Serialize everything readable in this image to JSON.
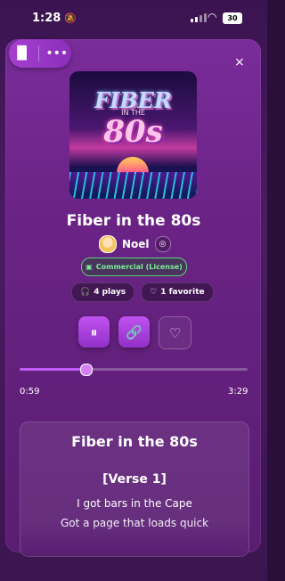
{
  "status_bar": {
    "time": "1:28",
    "battery": "30"
  },
  "controls": {
    "close_symbol": "×"
  },
  "song": {
    "title": "Fiber in the 80s",
    "artist": "Noel",
    "license": "Commercial (License)",
    "plays": "4 plays",
    "favorites": "1 favorite",
    "cover_text_top": "FIBER",
    "cover_text_mid": "IN THE",
    "cover_text_big": "80s"
  },
  "player": {
    "elapsed": "0:59",
    "duration": "3:29",
    "progress_fraction": 0.29
  },
  "lyrics": {
    "title": "Fiber in the 80s",
    "section": "[Verse 1]",
    "lines": [
      "I got bars in the Cape",
      "Got a page that loads quick"
    ]
  },
  "icons": [
    "waveform-icon",
    "more-icon",
    "close-icon",
    "pause-icon",
    "link-icon",
    "heart-icon",
    "headphones-icon",
    "license-icon",
    "user-badge-icon"
  ]
}
